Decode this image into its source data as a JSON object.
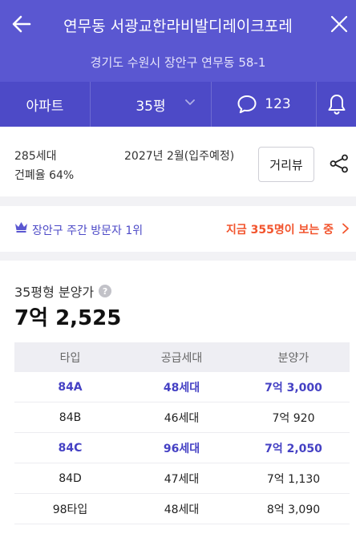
{
  "header": {
    "title": "연무동 서광교한라비발디레이크포레",
    "address": "경기도 수원시 장안구 연무동 58-1"
  },
  "tabs": {
    "type_label": "아파트",
    "size_label": "35평",
    "comment_count": "123"
  },
  "info": {
    "households": "285세대",
    "building_coverage": "건폐율 64%",
    "move_in": "2027년 2월(입주예정)",
    "street_view_label": "거리뷰"
  },
  "visit": {
    "rank_text": "장안구 주간 방문자 1위",
    "viewers_text": "지금 355명이 보는 중"
  },
  "price": {
    "label": "35평형 분양가",
    "help_glyph": "?",
    "amount": "7억 2,525",
    "table": {
      "headers": [
        "타입",
        "공급세대",
        "분양가"
      ],
      "rows": [
        {
          "type": "84A",
          "supply": "48세대",
          "price": "7억 3,000",
          "highlight": true
        },
        {
          "type": "84B",
          "supply": "46세대",
          "price": "7억 920",
          "highlight": false
        },
        {
          "type": "84C",
          "supply": "96세대",
          "price": "7억 2,050",
          "highlight": true
        },
        {
          "type": "84D",
          "supply": "47세대",
          "price": "7억 1,130",
          "highlight": false
        },
        {
          "type": "98타입",
          "supply": "48세대",
          "price": "8억 3,090",
          "highlight": false
        }
      ]
    }
  },
  "colors": {
    "header_bg": "#5a57d1",
    "tab_bg": "#4d4ac7",
    "accent": "#4541c4",
    "hot": "#f2542d"
  },
  "icons": {
    "back": "arrow-left-icon",
    "close": "close-icon",
    "chevron": "chevron-down-icon",
    "comment": "speech-bubble-icon",
    "bell": "bell-icon",
    "share": "share-icon",
    "crown": "crown-icon",
    "arrow": "chevron-right-icon"
  }
}
